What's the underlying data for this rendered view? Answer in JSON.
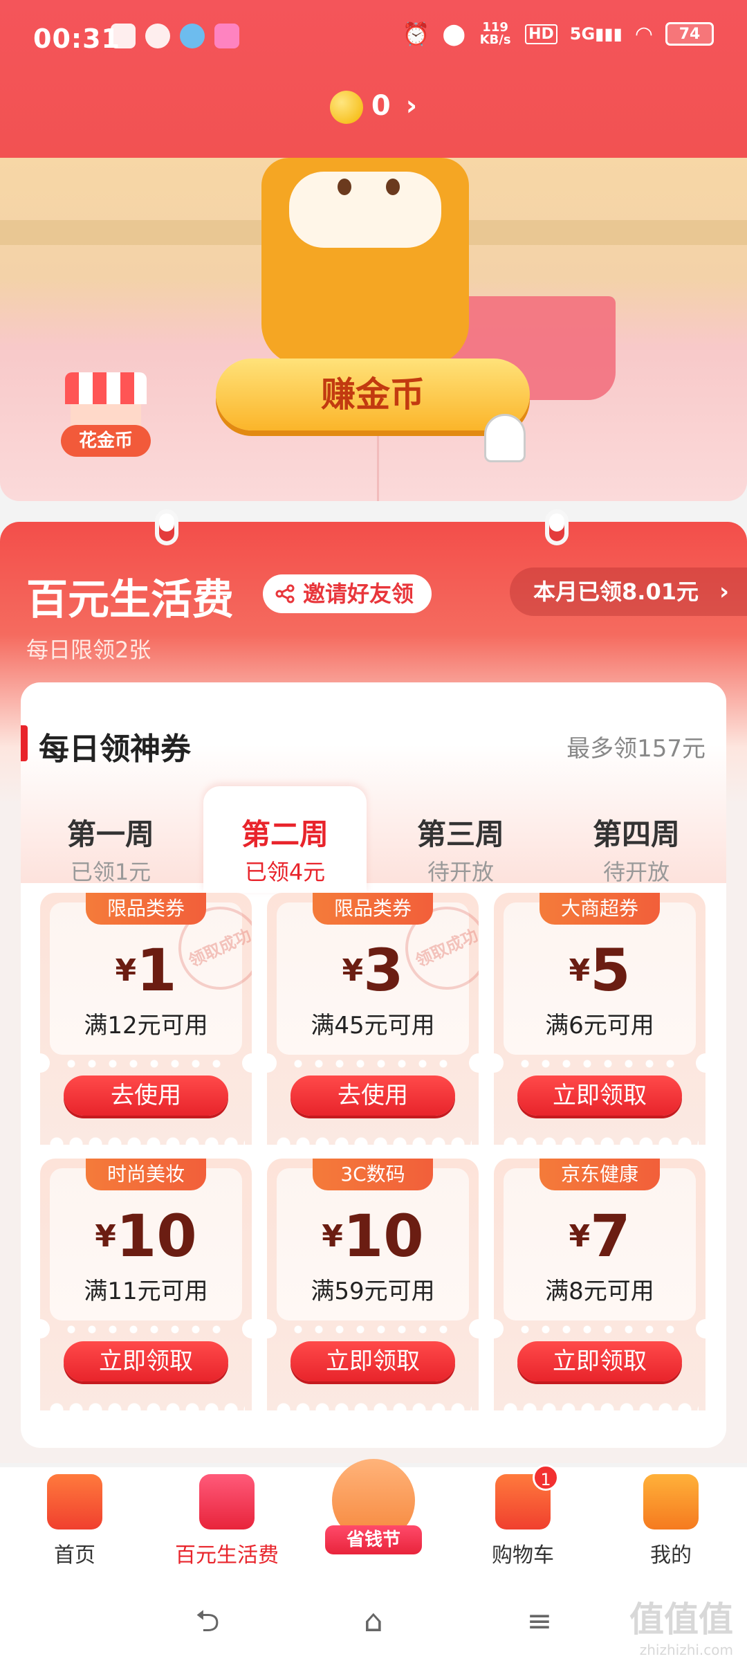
{
  "status_bar": {
    "time": "00:31",
    "net_speed": "119 KB/s",
    "battery": "74"
  },
  "coin": {
    "count": "0",
    "chevron": "›"
  },
  "banner": {
    "earn_button": "赚金币",
    "spend_button": "花金币"
  },
  "main": {
    "title": "百元生活费",
    "invite_label": "邀请好友领",
    "monthly_label": "本月已领8.01元",
    "monthly_chevron": "›",
    "subtitle": "每日限领2张",
    "section_title": "每日领神券",
    "max_text": "最多领157元",
    "weeks": [
      {
        "name": "第一周",
        "status": "已领1元"
      },
      {
        "name": "第二周",
        "status": "已领4元"
      },
      {
        "name": "第三周",
        "status": "待开放"
      },
      {
        "name": "第四周",
        "status": "待开放"
      }
    ],
    "coupons": [
      {
        "tag": "限品类券",
        "value": "1",
        "condition": "满12元可用",
        "button": "去使用",
        "stamp": "领取成功"
      },
      {
        "tag": "限品类券",
        "value": "3",
        "condition": "满45元可用",
        "button": "去使用",
        "stamp": "领取成功"
      },
      {
        "tag": "大商超券",
        "value": "5",
        "condition": "满6元可用",
        "button": "立即领取"
      },
      {
        "tag": "时尚美妆",
        "value": "10",
        "condition": "满11元可用",
        "button": "立即领取"
      },
      {
        "tag": "3C数码",
        "value": "10",
        "condition": "满59元可用",
        "button": "立即领取"
      },
      {
        "tag": "京东健康",
        "value": "7",
        "condition": "满8元可用",
        "button": "立即领取"
      }
    ],
    "currency": "¥"
  },
  "bottom_nav": {
    "items": [
      {
        "label": "首页"
      },
      {
        "label": "百元生活费"
      },
      {
        "label": "省钱节"
      },
      {
        "label": "购物车",
        "badge": "1"
      },
      {
        "label": "我的"
      }
    ]
  },
  "watermark": {
    "title": "值值值",
    "url": "zhizhizhi.com"
  },
  "colors": {
    "primary_red": "#e8242b",
    "header_red": "#f4555a",
    "coupon_value": "#6b1d12"
  }
}
